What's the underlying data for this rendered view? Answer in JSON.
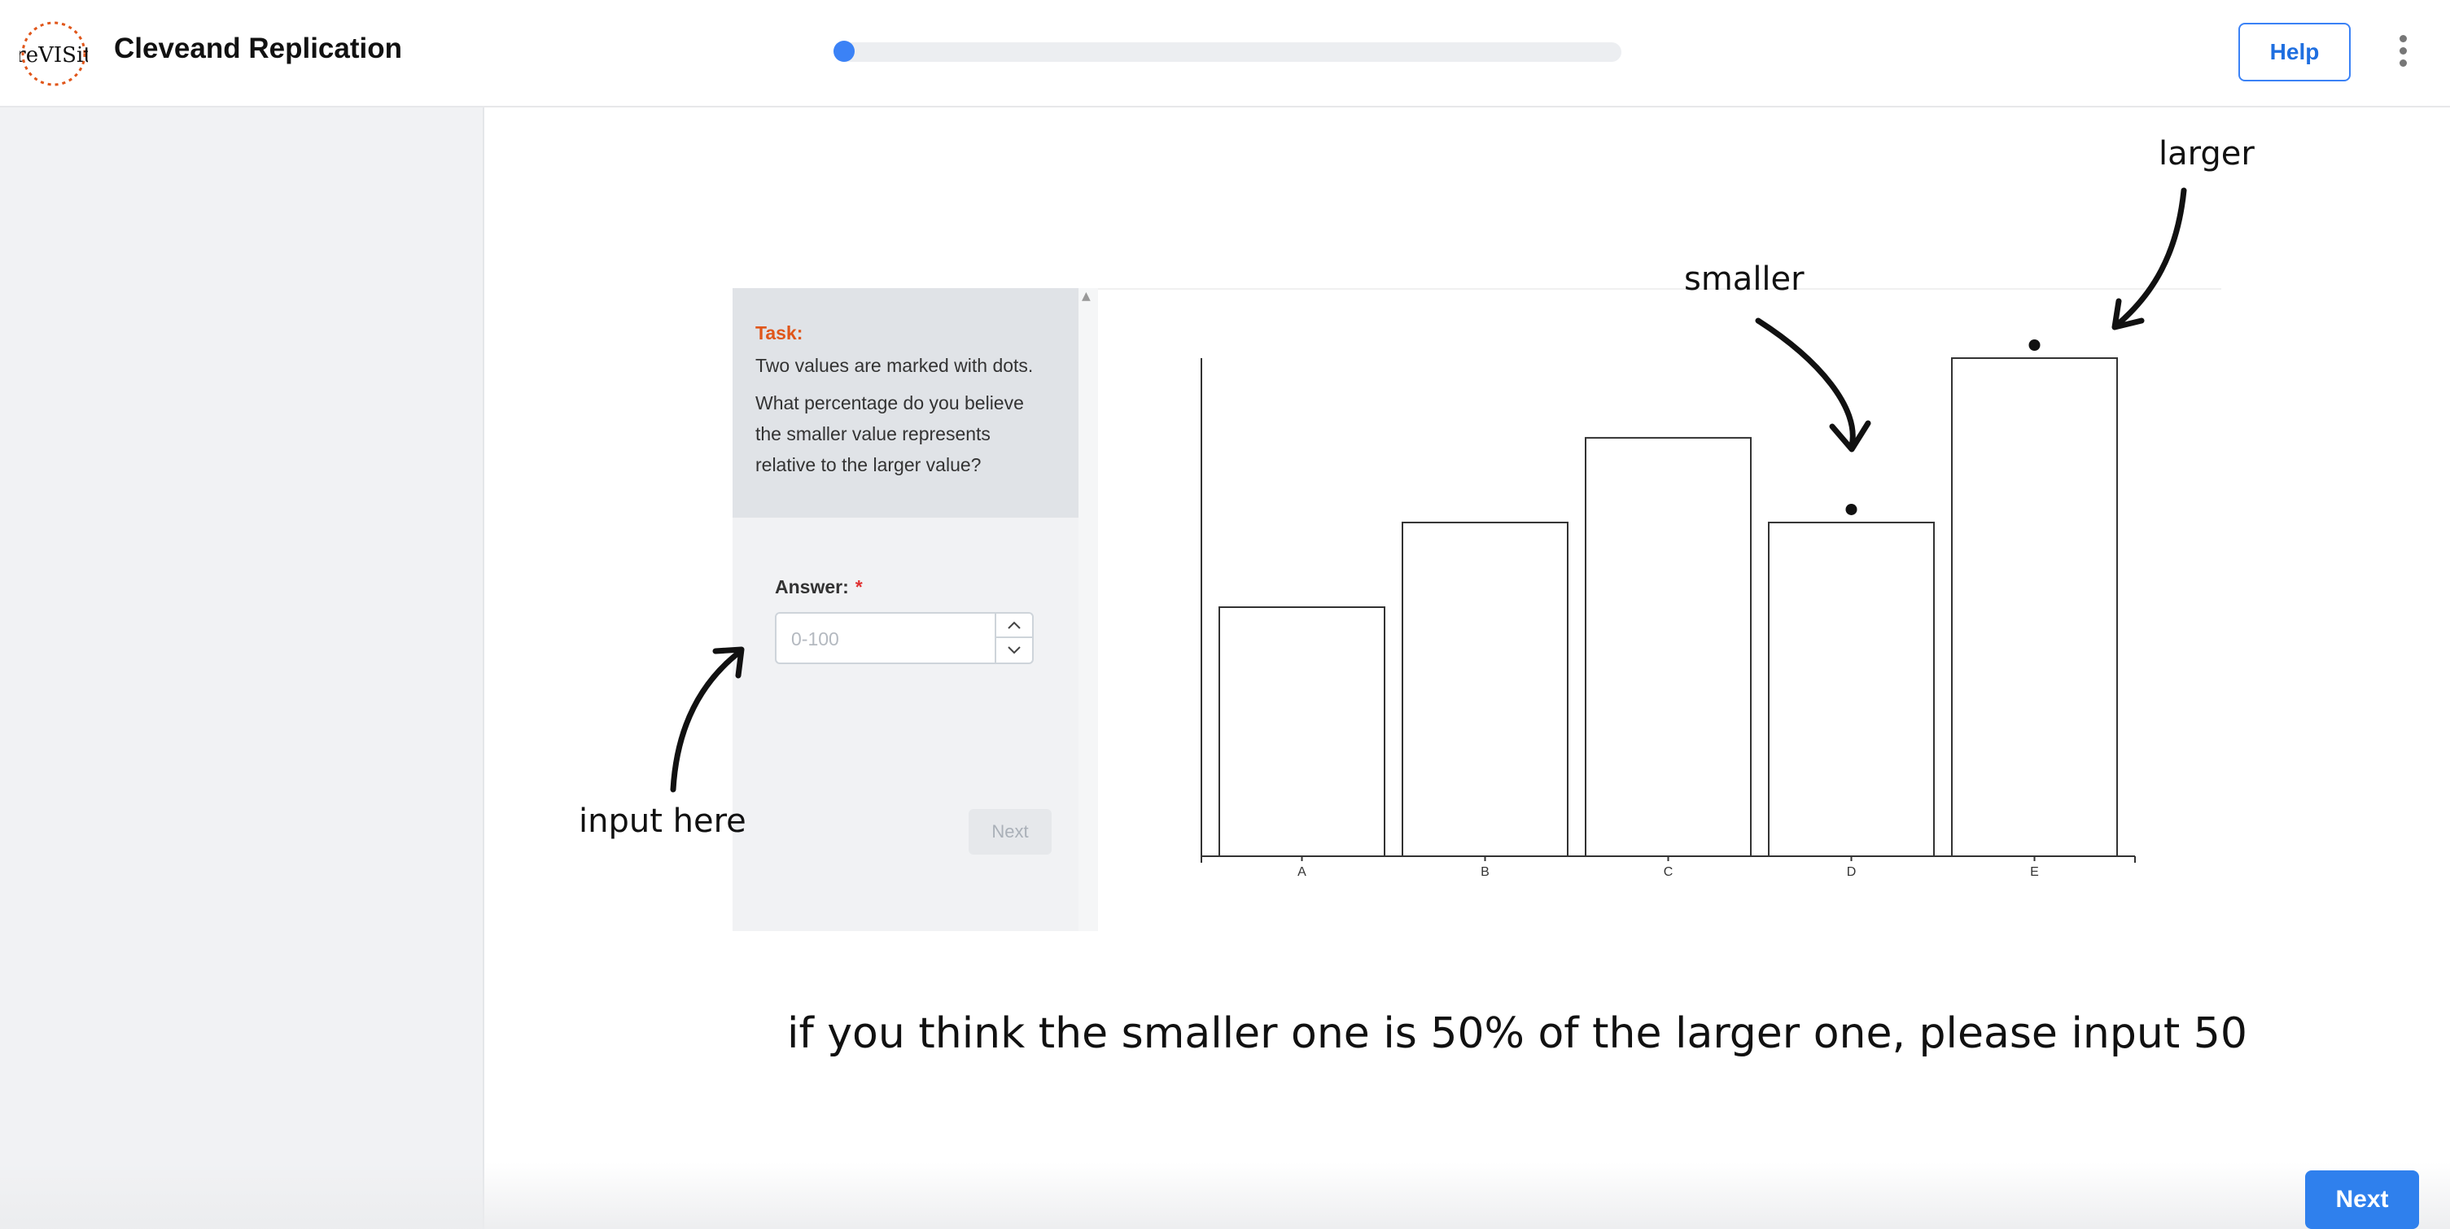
{
  "app": {
    "title": "Cleveand Replication",
    "logo_text": "reVISit"
  },
  "header": {
    "help_label": "Help",
    "menu_icon": "kebab-menu-icon",
    "progress": 0.0
  },
  "task_panel": {
    "task_label": "Task:",
    "line1": "Two values are marked with dots.",
    "line2": "What percentage do you believe the smaller value represents relative to the larger value?",
    "answer_label": "Answer:",
    "required_mark": "*",
    "answer_placeholder": "0-100",
    "answer_value": "",
    "next_label": "Next"
  },
  "annotations": {
    "smaller": "smaller",
    "larger": "larger",
    "input_here": "input here"
  },
  "instruction": "if you think the smaller one is 50% of the larger one, please input 50",
  "footer": {
    "next_label": "Next"
  },
  "colors": {
    "accent": "#2f80ed",
    "task_label": "#e0561a",
    "sidebar": "#f1f2f4"
  },
  "chart_data": {
    "type": "bar",
    "categories": [
      "A",
      "B",
      "C",
      "D",
      "E"
    ],
    "values": [
      50,
      67,
      84,
      67,
      100
    ],
    "marked": [
      "D",
      "E"
    ],
    "title": "",
    "xlabel": "",
    "ylabel": "",
    "ylim": [
      0,
      100
    ],
    "grid": false,
    "legend": "none"
  }
}
